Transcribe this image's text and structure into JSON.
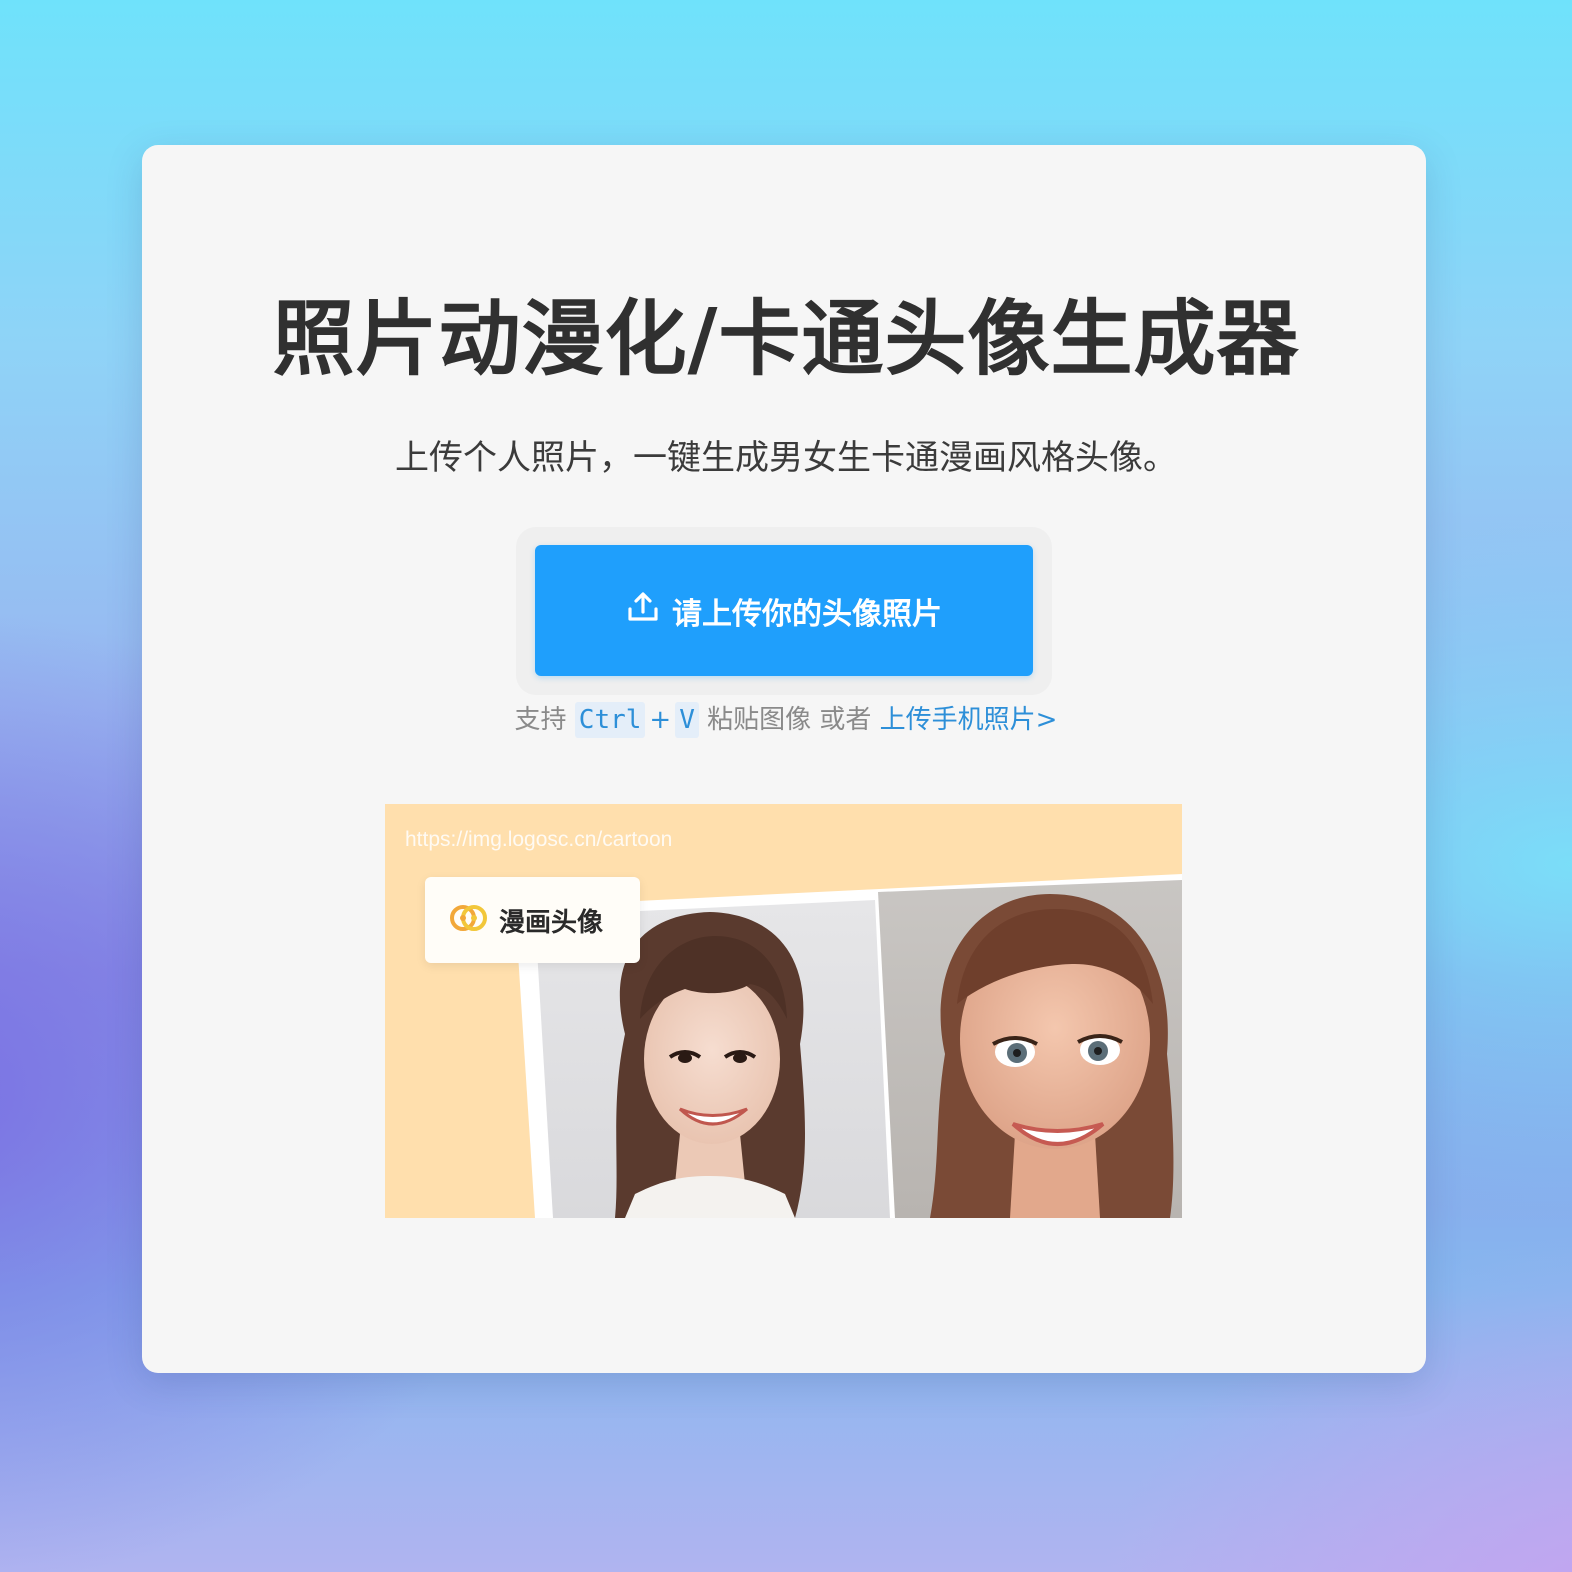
{
  "header": {
    "title": "照片动漫化/卡通头像生成器",
    "subtitle": "上传个人照片，一键生成男女生卡通漫画风格头像。"
  },
  "upload": {
    "button_label": "请上传你的头像照片",
    "icon": "upload-icon",
    "color": "#1f9ffc"
  },
  "hint": {
    "prefix": "支持",
    "key1": "Ctrl",
    "plus": "+",
    "key2": "V",
    "middle": "粘贴图像 或者",
    "link": "上传手机照片>"
  },
  "preview": {
    "watermark": "https://img.logosc.cn/cartoon",
    "logo_text": "漫画头像"
  }
}
